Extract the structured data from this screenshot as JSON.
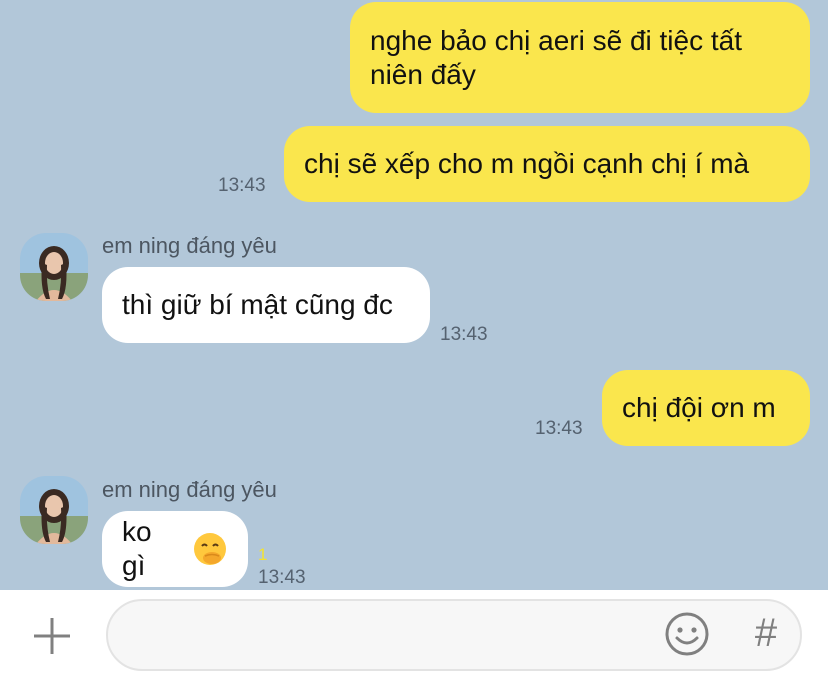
{
  "messages": [
    {
      "id": "m1",
      "side": "mine",
      "text": "nghe bảo chị aeri sẽ đi tiệc tất niên đấy"
    },
    {
      "id": "m2",
      "side": "mine",
      "text": "chị sẽ xếp cho m ngồi cạnh chị í mà",
      "time": "13:43"
    },
    {
      "id": "m3",
      "side": "theirs",
      "sender": "em ning đáng yêu",
      "text": "thì giữ bí mật cũng đc",
      "time": "13:43"
    },
    {
      "id": "m4",
      "side": "mine",
      "text": "chị đội ơn m",
      "time": "13:43"
    },
    {
      "id": "m5",
      "side": "theirs",
      "sender": "em ning đáng yêu",
      "text": "ko gì",
      "emoji": "face-with-hand-over-mouth-icon",
      "unread": "1",
      "time": "13:43"
    }
  ],
  "input_bar": {
    "placeholder": "",
    "plus_icon": "plus-icon",
    "emoji_icon": "smiley-icon",
    "hash_label": "#"
  },
  "colors": {
    "background": "#b2c7d9",
    "my_bubble": "#fae64d",
    "their_bubble": "#ffffff",
    "unread": "#f3e233"
  }
}
